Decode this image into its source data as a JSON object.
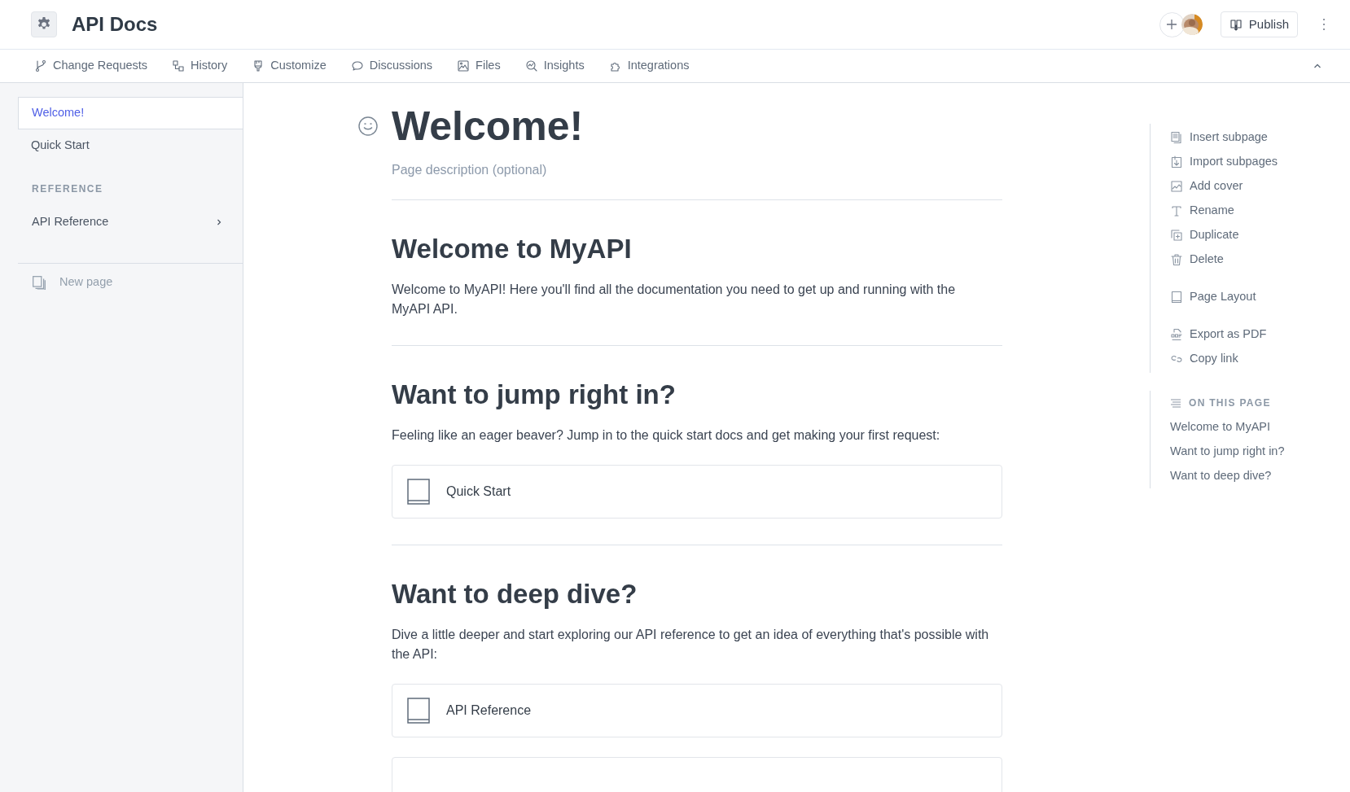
{
  "header": {
    "title": "API Docs",
    "publish": "Publish"
  },
  "tabs": [
    {
      "label": "Change Requests"
    },
    {
      "label": "History"
    },
    {
      "label": "Customize"
    },
    {
      "label": "Discussions"
    },
    {
      "label": "Files"
    },
    {
      "label": "Insights"
    },
    {
      "label": "Integrations"
    }
  ],
  "sidebar": {
    "items": [
      {
        "label": "Welcome!",
        "selected": true
      },
      {
        "label": "Quick Start",
        "selected": false
      }
    ],
    "section": "REFERENCE",
    "section_items": [
      {
        "label": "API Reference",
        "selected": false
      }
    ],
    "new_page": "New page"
  },
  "page": {
    "title": "Welcome!",
    "description_placeholder": "Page description (optional)",
    "sections": [
      {
        "heading": "Welcome to MyAPI",
        "text": "Welcome to MyAPI! Here you'll find all the documentation you need to get up and running with the MyAPI API."
      },
      {
        "heading": "Want to jump right in?",
        "text": "Feeling like an eager beaver? Jump in to the quick start docs and get making your first request:",
        "card": "Quick Start"
      },
      {
        "heading": "Want to deep dive?",
        "text": "Dive a little deeper and start exploring our API reference to get an idea of everything that's possible with the API:",
        "card": "API Reference"
      }
    ]
  },
  "actions": [
    [
      "Insert subpage",
      "Import subpages",
      "Add cover",
      "Rename",
      "Duplicate",
      "Delete"
    ],
    [
      "Page Layout"
    ],
    [
      "Export as PDF",
      "Copy link"
    ]
  ],
  "on_this_page": {
    "title": "ON THIS PAGE",
    "items": [
      "Welcome to MyAPI",
      "Want to jump right in?",
      "Want to deep dive?"
    ]
  }
}
